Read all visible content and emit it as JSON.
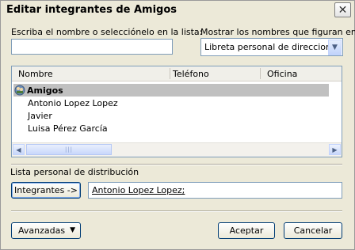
{
  "dialog": {
    "title": "Editar integrantes de Amigos",
    "close_symbol": "✕"
  },
  "search": {
    "label": "Escriba el nombre o selecciónelo en la lista:",
    "value": ""
  },
  "address_book": {
    "label": "Mostrar los nombres que figuran en:",
    "selected": "Libreta personal de direcciones"
  },
  "list": {
    "columns": [
      "Nombre",
      "Teléfono",
      "Oficina"
    ],
    "group_row": "Amigos",
    "rows": [
      "Antonio Lopez Lopez",
      "Javier",
      "Luisa Pérez García"
    ]
  },
  "distribution": {
    "label": "Lista personal de distribución",
    "members_button": "Integrantes ->",
    "members_value": "Antonio Lopez Lopez;"
  },
  "footer": {
    "advanced_button": "Avanzadas",
    "accept_button": "Aceptar",
    "cancel_button": "Cancelar"
  },
  "icons": {
    "group": "distribution-list-icon",
    "close": "close-icon",
    "dropdown": "chevron-down-icon"
  }
}
